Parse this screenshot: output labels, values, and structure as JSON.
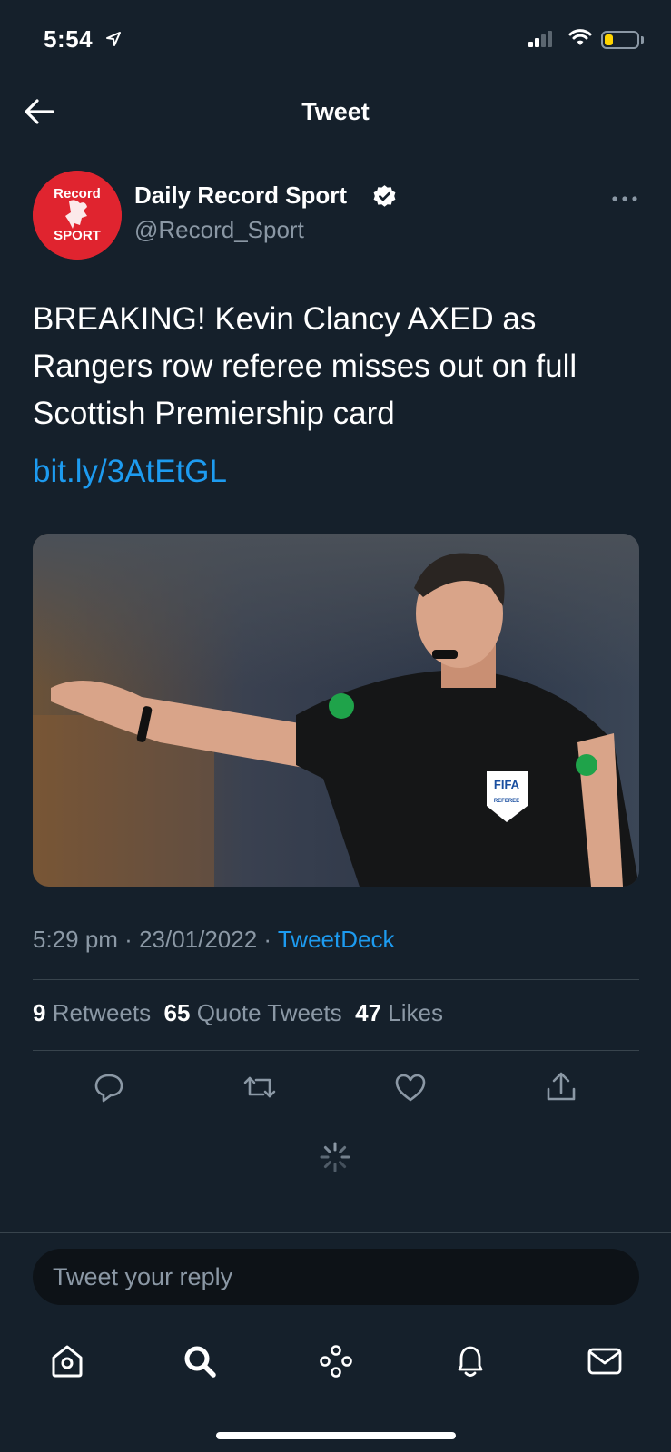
{
  "status_bar": {
    "time": "5:54",
    "battery_level": 0.25
  },
  "header": {
    "title": "Tweet",
    "back_icon": "arrow-left-icon"
  },
  "author": {
    "name": "Daily Record Sport",
    "handle": "@Record_Sport",
    "verified": true,
    "avatar": {
      "line1": "Record",
      "line2": "SPORT",
      "color": "#e0242f"
    }
  },
  "tweet": {
    "text": "BREAKING! Kevin Clancy AXED as Rangers row referee misses out on full Scottish Premiership card",
    "link": "bit.ly/3AtEtGL",
    "media": {
      "badge_text": "FIFA",
      "badge_sub": "REFEREE"
    },
    "time": "5:29 pm",
    "date": "23/01/2022",
    "source": "TweetDeck"
  },
  "stats": {
    "retweets_count": "9",
    "retweets_label": "Retweets",
    "quotes_count": "65",
    "quotes_label": "Quote Tweets",
    "likes_count": "47",
    "likes_label": "Likes"
  },
  "reply": {
    "placeholder": "Tweet your reply"
  },
  "actions": [
    "reply-icon",
    "retweet-icon",
    "like-icon",
    "share-icon"
  ],
  "nav": [
    "home-icon",
    "search-icon",
    "spaces-icon",
    "notifications-icon",
    "messages-icon"
  ],
  "colors": {
    "background": "#15202b",
    "accent": "#1d9bf0",
    "muted": "#8b98a5",
    "divider": "#38444d"
  }
}
